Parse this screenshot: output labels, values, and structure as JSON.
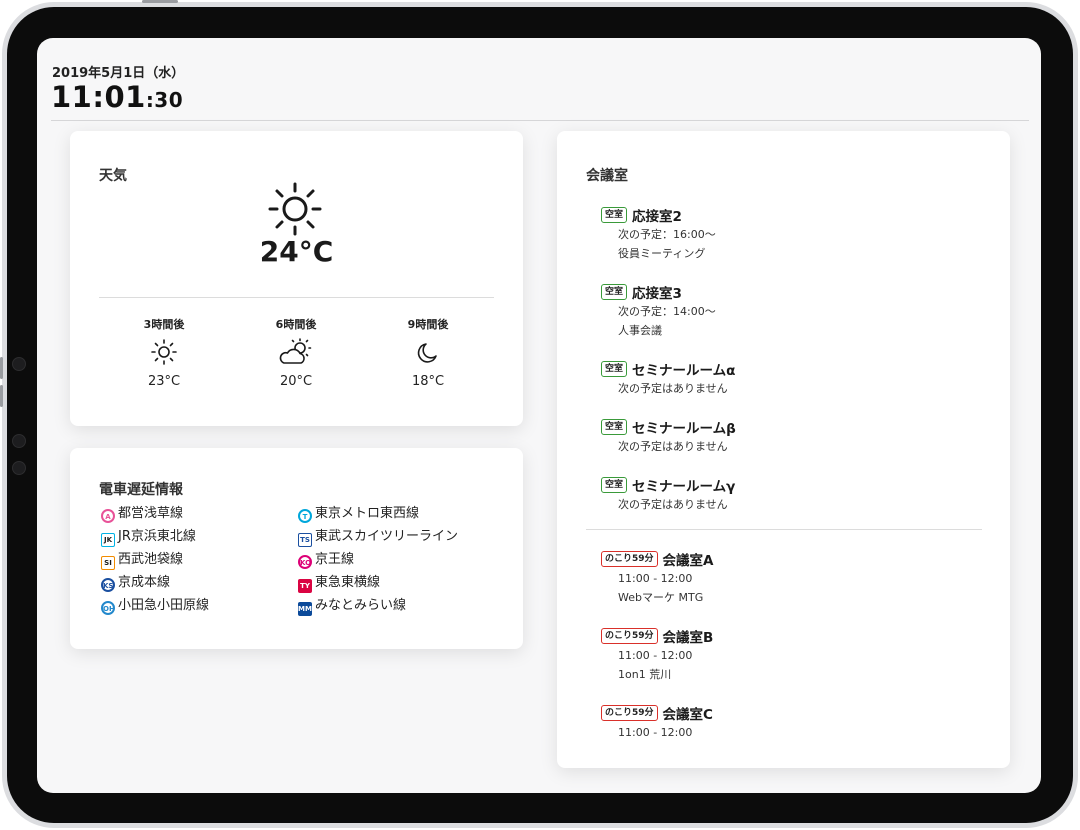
{
  "header": {
    "date": "2019年5月1日（水）",
    "time_hm": "11:01",
    "time_sec": ":30"
  },
  "weather": {
    "title": "天気",
    "current_temp": "24°C",
    "current_icon": "sun-icon",
    "forecast": [
      {
        "label": "3時間後",
        "icon": "sun-icon",
        "temp": "23°C"
      },
      {
        "label": "6時間後",
        "icon": "partly-cloudy-icon",
        "temp": "20°C"
      },
      {
        "label": "9時間後",
        "icon": "moon-icon",
        "temp": "18°C"
      }
    ]
  },
  "trains": {
    "title": "電車遅延情報",
    "lines": [
      {
        "name": "都営浅草線",
        "badge": "A",
        "color": "#e85298"
      },
      {
        "name": "東京メトロ東西線",
        "badge": "T",
        "color": "#00a7db"
      },
      {
        "name": "JR京浜東北線",
        "badge": "JK",
        "color": "#00b2e5"
      },
      {
        "name": "東武スカイツリーライン",
        "badge": "TS",
        "color": "#1a4fa0"
      },
      {
        "name": "西武池袋線",
        "badge": "SI",
        "color": "#f28c00"
      },
      {
        "name": "京王線",
        "badge": "KO",
        "color": "#dd0077"
      },
      {
        "name": "京成本線",
        "badge": "KS",
        "color": "#1a4fa0"
      },
      {
        "name": "東急東横線",
        "badge": "TY",
        "color": "#da0442"
      },
      {
        "name": "小田急小田原線",
        "badge": "OH",
        "color": "#2288cc"
      },
      {
        "name": "みなとみらい線",
        "badge": "MM",
        "color": "#0b4a9a"
      }
    ]
  },
  "rooms": {
    "title": "会議室",
    "free_tag": "空室",
    "busy_tag": "のこり59分",
    "free": [
      {
        "name": "応接室2",
        "next": "次の予定：16:00〜",
        "detail": "役員ミーティング"
      },
      {
        "name": "応接室3",
        "next": "次の予定：14:00〜",
        "detail": "人事会議"
      },
      {
        "name": "セミナールームα",
        "next": "次の予定はありません",
        "detail": ""
      },
      {
        "name": "セミナールームβ",
        "next": "次の予定はありません",
        "detail": ""
      },
      {
        "name": "セミナールームγ",
        "next": "次の予定はありません",
        "detail": ""
      }
    ],
    "busy": [
      {
        "name": "会議室A",
        "time": "11:00 - 12:00",
        "detail": "Webマーケ MTG"
      },
      {
        "name": "会議室B",
        "time": "11:00 - 12:00",
        "detail": "1on1 荒川"
      },
      {
        "name": "会議室C",
        "time": "11:00 - 12:00",
        "detail": ""
      }
    ]
  }
}
